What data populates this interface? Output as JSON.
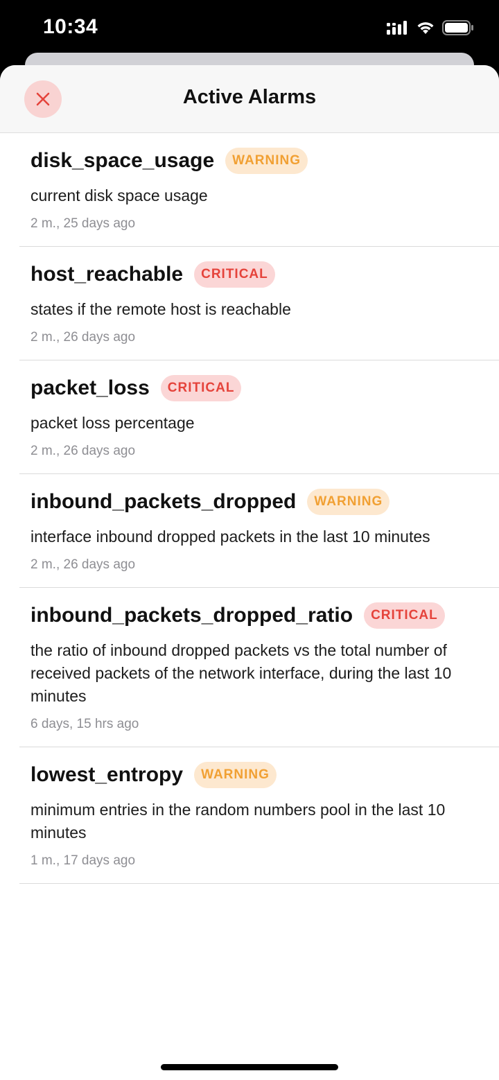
{
  "status": {
    "time": "10:34"
  },
  "header": {
    "title": "Active Alarms",
    "close_icon": "close-icon"
  },
  "colors": {
    "warning_bg": "#fde8cf",
    "warning_text": "#f1a033",
    "critical_bg": "#fbd6d6",
    "critical_text": "#e5433b",
    "close_bg": "#f9d3d2"
  },
  "alarms": [
    {
      "name": "disk_space_usage",
      "severity": "WARNING",
      "description": "current disk space usage",
      "time": "2 m., 25 days ago"
    },
    {
      "name": "host_reachable",
      "severity": "CRITICAL",
      "description": "states if the remote host is reachable",
      "time": "2 m., 26 days ago"
    },
    {
      "name": "packet_loss",
      "severity": "CRITICAL",
      "description": "packet loss percentage",
      "time": "2 m., 26 days ago"
    },
    {
      "name": "inbound_packets_dropped",
      "severity": "WARNING",
      "description": "interface inbound dropped packets in the last 10 minutes",
      "time": "2 m., 26 days ago"
    },
    {
      "name": "inbound_packets_dropped_ratio",
      "severity": "CRITICAL",
      "description": "the ratio of inbound dropped packets vs the total number of received packets of the network interface, during the last 10 minutes",
      "time": "6 days, 15 hrs ago"
    },
    {
      "name": "lowest_entropy",
      "severity": "WARNING",
      "description": "minimum entries in the random numbers pool in the last 10 minutes",
      "time": "1 m., 17 days ago"
    }
  ]
}
